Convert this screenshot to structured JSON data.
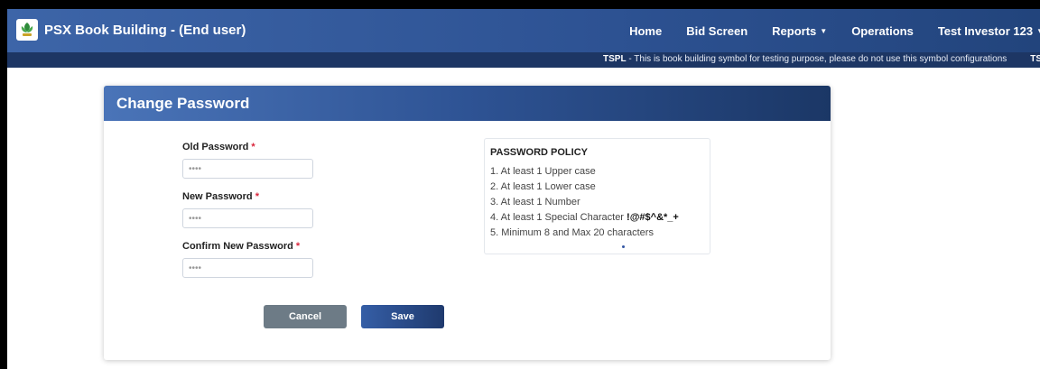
{
  "app": {
    "title": "PSX Book Building - (End user)",
    "logo_icon": "psx-logo-icon"
  },
  "nav": [
    {
      "label": "Home",
      "dropdown": false
    },
    {
      "label": "Bid Screen",
      "dropdown": false
    },
    {
      "label": "Reports",
      "dropdown": true
    },
    {
      "label": "Operations",
      "dropdown": false
    },
    {
      "label": "Test Investor 123",
      "dropdown": true
    }
  ],
  "ticker": {
    "items": [
      {
        "symbol": "TSPL",
        "text": " - This is book building symbol for testing purpose, please do not use this symbol configurations"
      },
      {
        "symbol": "TSML",
        "text": " - "
      }
    ]
  },
  "card": {
    "title": "Change Password"
  },
  "form": {
    "old_password": {
      "label": "Old Password",
      "required_mark": "*",
      "value": "••••"
    },
    "new_password": {
      "label": "New Password",
      "required_mark": "*",
      "value": "••••"
    },
    "confirm_password": {
      "label": "Confirm New Password",
      "required_mark": "*",
      "value": "••••"
    }
  },
  "policy": {
    "title": "PASSWORD POLICY",
    "items": [
      "1. At least 1 Upper case",
      "2. At least 1 Lower case",
      "3. At least 1 Number",
      "4. At least 1 Special Character ",
      "5. Minimum 8 and Max 20 characters"
    ],
    "special_chars": "!@#$^&*_+"
  },
  "buttons": {
    "cancel": "Cancel",
    "save": "Save"
  },
  "colors": {
    "navbar": "#2e5394",
    "ticker": "#1d3664",
    "cancel": "#6d7b86",
    "save": "#2a4c8c",
    "required": "#d9263c"
  }
}
